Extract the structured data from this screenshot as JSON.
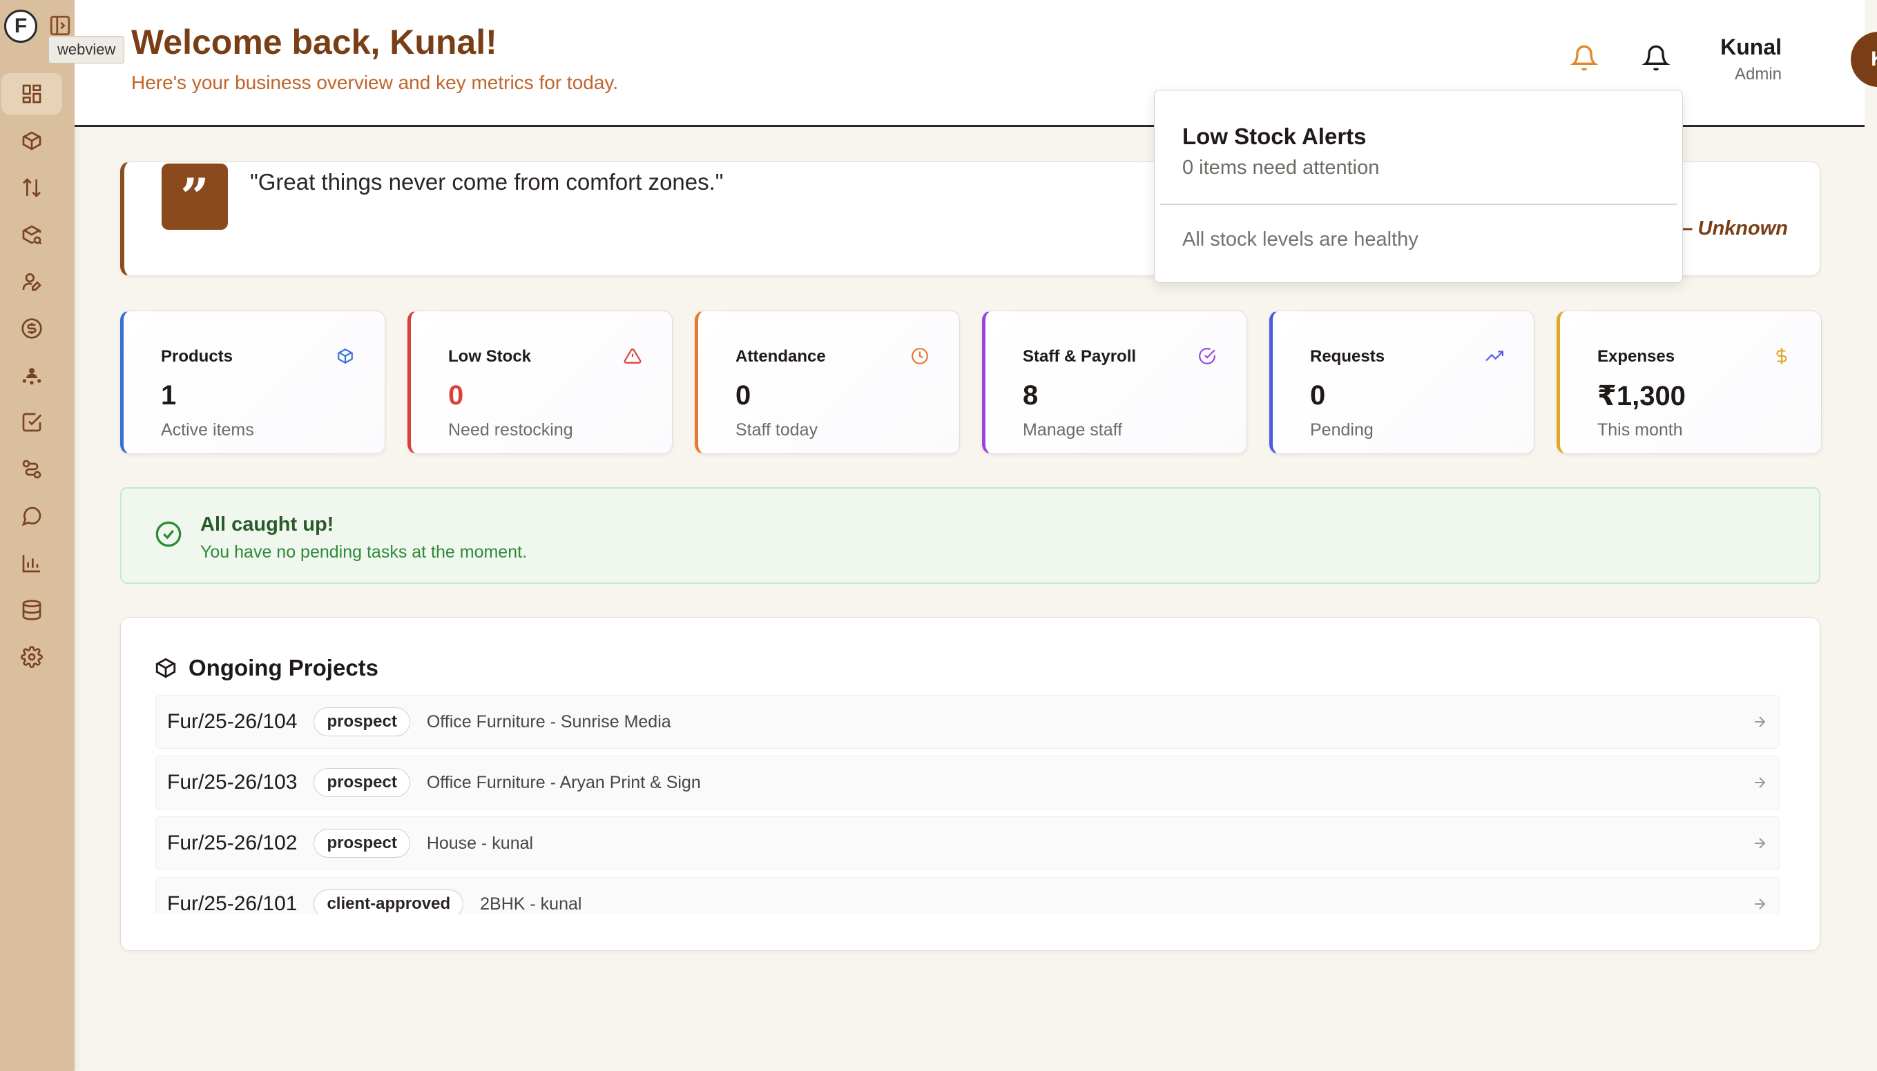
{
  "sidebar": {
    "logo_letter": "F",
    "tooltip": "webview",
    "items": [
      {
        "name": "dashboard-icon"
      },
      {
        "name": "box-icon"
      },
      {
        "name": "arrows-updown-icon"
      },
      {
        "name": "package-search-icon"
      },
      {
        "name": "user-edit-icon"
      },
      {
        "name": "dollar-circle-icon"
      },
      {
        "name": "user-network-icon"
      },
      {
        "name": "checkbox-icon"
      },
      {
        "name": "route-icon"
      },
      {
        "name": "chat-icon"
      },
      {
        "name": "bar-chart-icon"
      },
      {
        "name": "database-icon"
      },
      {
        "name": "settings-icon"
      }
    ]
  },
  "header": {
    "title": "Welcome back, Kunal!",
    "subtitle": "Here's your business overview and key metrics for today.",
    "user_name": "Kunal",
    "user_role": "Admin",
    "avatar_initial": "K"
  },
  "quote": {
    "text": "\"Great things never come from comfort zones.\"",
    "author": "— Unknown"
  },
  "dropdown": {
    "title": "Low Stock Alerts",
    "subtitle": "0 items need attention",
    "empty": "All stock levels are healthy"
  },
  "stats": [
    {
      "label": "Products",
      "value": "1",
      "desc": "Active items",
      "color": "#3b6fd8",
      "icon": "cube-icon"
    },
    {
      "label": "Low Stock",
      "value": "0",
      "desc": "Need restocking",
      "color": "#d9413a",
      "icon": "warning-icon"
    },
    {
      "label": "Attendance",
      "value": "0",
      "desc": "Staff today",
      "color": "#e67a2e",
      "icon": "clock-icon"
    },
    {
      "label": "Staff & Payroll",
      "value": "8",
      "desc": "Manage staff",
      "color": "#9747e0",
      "icon": "check-circle-icon"
    },
    {
      "label": "Requests",
      "value": "0",
      "desc": "Pending",
      "color": "#4f5ae0",
      "icon": "trending-up-icon"
    },
    {
      "label": "Expenses",
      "value": "₹1,300",
      "desc": "This month",
      "color": "#e0a925",
      "icon": "dollar-icon"
    }
  ],
  "caughtup": {
    "title": "All caught up!",
    "subtitle": "You have no pending tasks at the moment."
  },
  "projects": {
    "title": "Ongoing Projects",
    "rows": [
      {
        "code": "Fur/25-26/104",
        "tag": "prospect",
        "name": "Office Furniture - Sunrise Media"
      },
      {
        "code": "Fur/25-26/103",
        "tag": "prospect",
        "name": "Office Furniture - Aryan Print & Sign"
      },
      {
        "code": "Fur/25-26/102",
        "tag": "prospect",
        "name": "House - kunal"
      },
      {
        "code": "Fur/25-26/101",
        "tag": "client-approved",
        "name": "2BHK - kunal"
      }
    ]
  }
}
